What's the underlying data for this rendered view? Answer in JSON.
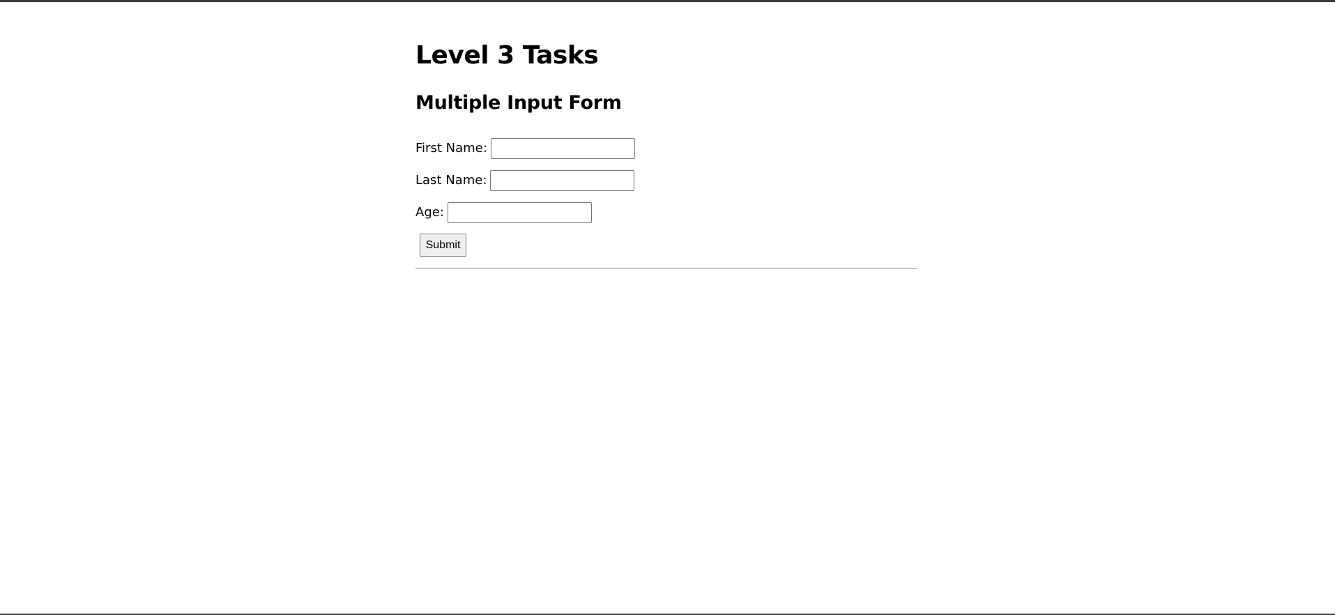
{
  "page": {
    "title": "Level 3 Tasks",
    "section_title": "Multiple Input Form"
  },
  "form": {
    "first_name": {
      "label": "First Name:",
      "value": "",
      "placeholder": ""
    },
    "last_name": {
      "label": "Last Name:",
      "value": "",
      "placeholder": ""
    },
    "age": {
      "label": "Age:",
      "value": "",
      "placeholder": ""
    },
    "submit_label": "Submit"
  },
  "colors": {
    "background": "#ffffff",
    "text": "#000000",
    "input_border": "#767676",
    "button_background": "#efefef",
    "divider": "#9a9a9a"
  }
}
